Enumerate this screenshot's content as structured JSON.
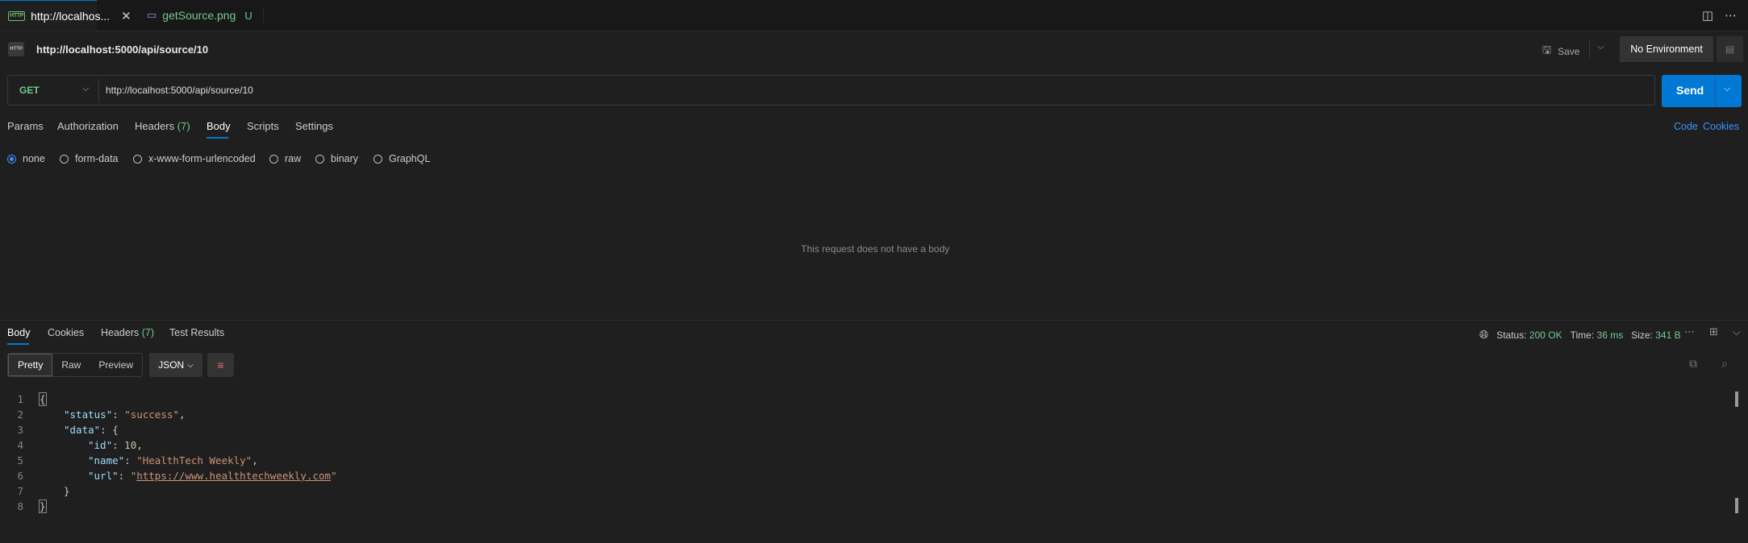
{
  "tabs": [
    {
      "label": "http://localhos...",
      "badge": "HTTP",
      "modified": true
    },
    {
      "label": "getSource.png",
      "status": "U"
    }
  ],
  "request": {
    "title": "http://localhost:5000/api/source/10",
    "method": "GET",
    "url": "http://localhost:5000/api/source/10",
    "save_label": "Save",
    "environment": "No Environment",
    "send_label": "Send"
  },
  "request_tabs": [
    {
      "label": "Params"
    },
    {
      "label": "Authorization"
    },
    {
      "label": "Headers",
      "count": "(7)"
    },
    {
      "label": "Body",
      "active": true
    },
    {
      "label": "Scripts"
    },
    {
      "label": "Settings"
    }
  ],
  "request_links": {
    "code": "Code",
    "cookies": "Cookies"
  },
  "body_types": [
    "none",
    "form-data",
    "x-www-form-urlencoded",
    "raw",
    "binary",
    "GraphQL"
  ],
  "body_selected": "none",
  "no_body_message": "This request does not have a body",
  "response_tabs": [
    {
      "label": "Body",
      "active": true
    },
    {
      "label": "Cookies"
    },
    {
      "label": "Headers",
      "count": "(7)"
    },
    {
      "label": "Test Results"
    }
  ],
  "response_status": {
    "status_label": "Status:",
    "status_value": "200 OK",
    "time_label": "Time:",
    "time_value": "36 ms",
    "size_label": "Size:",
    "size_value": "341 B"
  },
  "view_modes": [
    "Pretty",
    "Raw",
    "Preview"
  ],
  "view_selected": "Pretty",
  "format": "JSON",
  "json_lines": [
    {
      "num": "1",
      "text": "{"
    },
    {
      "num": "2",
      "key": "\"status\"",
      "value": "\"success\"",
      "tail": ","
    },
    {
      "num": "3",
      "key": "\"data\"",
      "tail": " {"
    },
    {
      "num": "4",
      "key": "\"id\"",
      "value": "10",
      "tail": ","
    },
    {
      "num": "5",
      "key": "\"name\"",
      "value": "\"HealthTech Weekly\"",
      "tail": ","
    },
    {
      "num": "6",
      "key": "\"url\"",
      "value_prefix": "\"",
      "link": "https://www.healthtechweekly.com",
      "value_suffix": "\""
    },
    {
      "num": "7",
      "text": "}"
    },
    {
      "num": "8",
      "text": "}"
    }
  ]
}
